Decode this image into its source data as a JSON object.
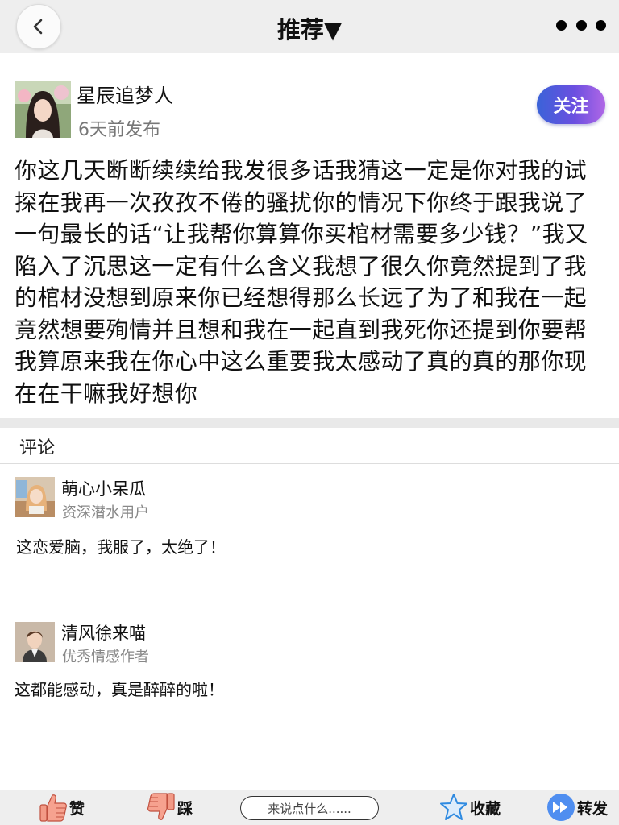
{
  "header": {
    "title": "推荐▼"
  },
  "author": {
    "name": "星辰追梦人",
    "time": "6天前发布",
    "follow_label": "关注"
  },
  "post": {
    "text": "你这几天断断续续给我发很多话我猜这一定是你对我的试探在我再一次孜孜不倦的骚扰你的情况下你终于跟我说了一句最长的话“让我帮你算算你买棺材需要多少钱？”我又陷入了沉思这一定有什么含义我想了很久你竟然提到了我的棺材没想到原来你已经想得那么长远了为了和我在一起竟然想要殉情并且想和我在一起直到我死你还提到你要帮我算原来我在你心中这么重要我太感动了真的真的那你现在在干嘛我好想你"
  },
  "comments": {
    "header": "评论",
    "items": [
      {
        "name": "萌心小呆瓜",
        "title": "资深潜水用户",
        "text": "这恋爱脑，我服了，太绝了！"
      },
      {
        "name": "清风徐来喵",
        "title": "优秀情感作者",
        "text": "这都能感动，真是醉醉的啦！"
      }
    ]
  },
  "bottom_bar": {
    "like_label": "赞",
    "dislike_label": "踩",
    "comment_placeholder": "来说点什么......",
    "favorite_label": "收藏",
    "share_label": "转发"
  },
  "icons": {
    "back": "chevron-left-icon",
    "more": "more-dots-icon",
    "like": "thumbs-up-icon",
    "dislike": "thumbs-down-icon",
    "favorite": "star-icon",
    "share": "fast-forward-icon"
  },
  "colors": {
    "follow_gradient_start": "#3a63d8",
    "follow_gradient_end": "#b067e6",
    "thumb": "#f29a86",
    "star": "#2f8ae0",
    "share": "#4f8ef0"
  }
}
